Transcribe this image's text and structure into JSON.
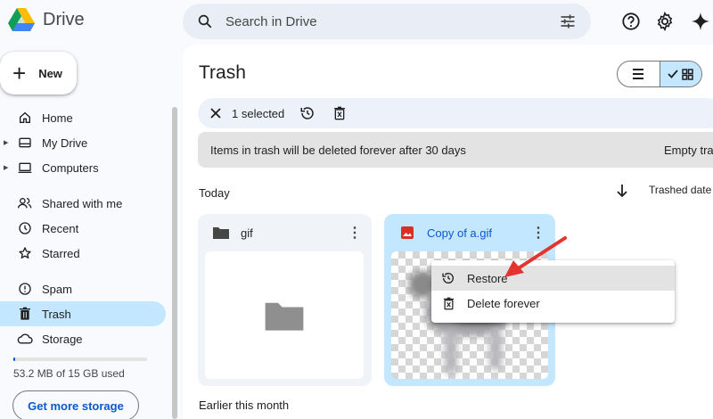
{
  "header": {
    "app_name": "Drive",
    "search_placeholder": "Search in Drive"
  },
  "sidebar": {
    "new_label": "New",
    "items": [
      {
        "label": "Home",
        "icon": "home-icon"
      },
      {
        "label": "My Drive",
        "icon": "my-drive-icon"
      },
      {
        "label": "Computers",
        "icon": "computers-icon"
      },
      {
        "label": "Shared with me",
        "icon": "shared-icon"
      },
      {
        "label": "Recent",
        "icon": "clock-icon"
      },
      {
        "label": "Starred",
        "icon": "star-icon"
      },
      {
        "label": "Spam",
        "icon": "spam-icon"
      },
      {
        "label": "Trash",
        "icon": "trash-icon"
      },
      {
        "label": "Storage",
        "icon": "cloud-icon"
      }
    ],
    "storage_text": "53.2 MB of 15 GB used",
    "storage_used_fraction": 0.0035,
    "more_storage_label": "Get more storage"
  },
  "main": {
    "title": "Trash",
    "selection_count": "1 selected",
    "notice": "Items in trash will be deleted forever after 30 days",
    "notice_action": "Empty tra",
    "section_today": "Today",
    "sort_label": "Trashed date",
    "section_earlier": "Earlier this month",
    "files": [
      {
        "name": "gif",
        "type": "folder",
        "selected": false
      },
      {
        "name": "Copy of a.gif",
        "type": "image",
        "selected": true
      }
    ]
  },
  "context_menu": {
    "items": [
      {
        "label": "Restore",
        "icon": "restore-icon"
      },
      {
        "label": "Delete forever",
        "icon": "delete-forever-icon"
      }
    ]
  },
  "colors": {
    "accent": "#0b57d0",
    "selected_bg": "#c2e7ff",
    "annotation_arrow": "#e3342f"
  }
}
